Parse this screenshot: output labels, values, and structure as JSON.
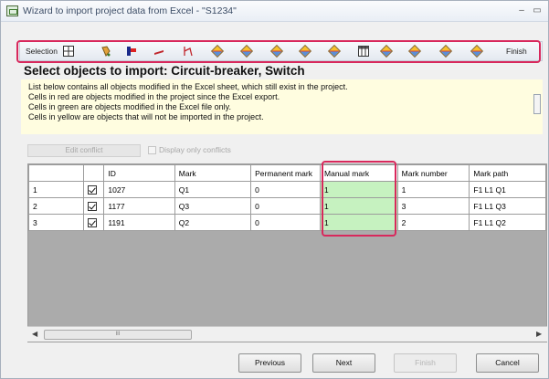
{
  "window": {
    "title": "Wizard to import project data from Excel - \"S1234\"",
    "minimize_glyph": "–",
    "maximize_glyph": "▭"
  },
  "toolbar": {
    "selection_label": "Selection",
    "finish_label": "Finish",
    "icons": [
      "selection-grid-icon",
      "fill-bucket-icon",
      "color-flag-icon",
      "pen-icon",
      "line-tool-icon",
      "diamond-icon",
      "diamond-icon",
      "diamond-icon",
      "diamond-icon",
      "diamond-icon",
      "table-icon",
      "diamond-icon",
      "diamond-icon",
      "diamond-icon",
      "diamond-icon"
    ]
  },
  "heading": "Select objects to import: Circuit-breaker, Switch",
  "info_lines": [
    "List below contains all objects modified in the Excel sheet, which still exist in the project.",
    "Cells in red are objects modified in the project since the Excel export.",
    "Cells in green are objects modified in the Excel file only.",
    "Cells in yellow are objects that will not be imported in the project."
  ],
  "edit_conflict_label": "Edit conflict",
  "display_only_conflicts_label": "Display only conflicts",
  "table": {
    "columns": [
      "",
      "",
      "ID",
      "Mark",
      "Permanent mark",
      "Manual mark",
      "Mark number",
      "Mark path"
    ],
    "rows": [
      {
        "num": "1",
        "checked": true,
        "id": "1027",
        "mark": "Q1",
        "permanent": "0",
        "manual": "1",
        "mark_number": "1",
        "path": "F1 L1 Q1"
      },
      {
        "num": "2",
        "checked": true,
        "id": "1177",
        "mark": "Q3",
        "permanent": "0",
        "manual": "1",
        "mark_number": "3",
        "path": "F1 L1 Q3"
      },
      {
        "num": "3",
        "checked": true,
        "id": "1191",
        "mark": "Q2",
        "permanent": "0",
        "manual": "1",
        "mark_number": "2",
        "path": "F1 L1 Q2"
      }
    ]
  },
  "scrollbar_grip": "III",
  "buttons": {
    "previous": "Previous",
    "next": "Next",
    "finish": "Finish",
    "cancel": "Cancel"
  },
  "colors": {
    "highlight": "#d8285c",
    "modified_in_excel": "#c6f2c0",
    "info_background": "#fffde0"
  }
}
